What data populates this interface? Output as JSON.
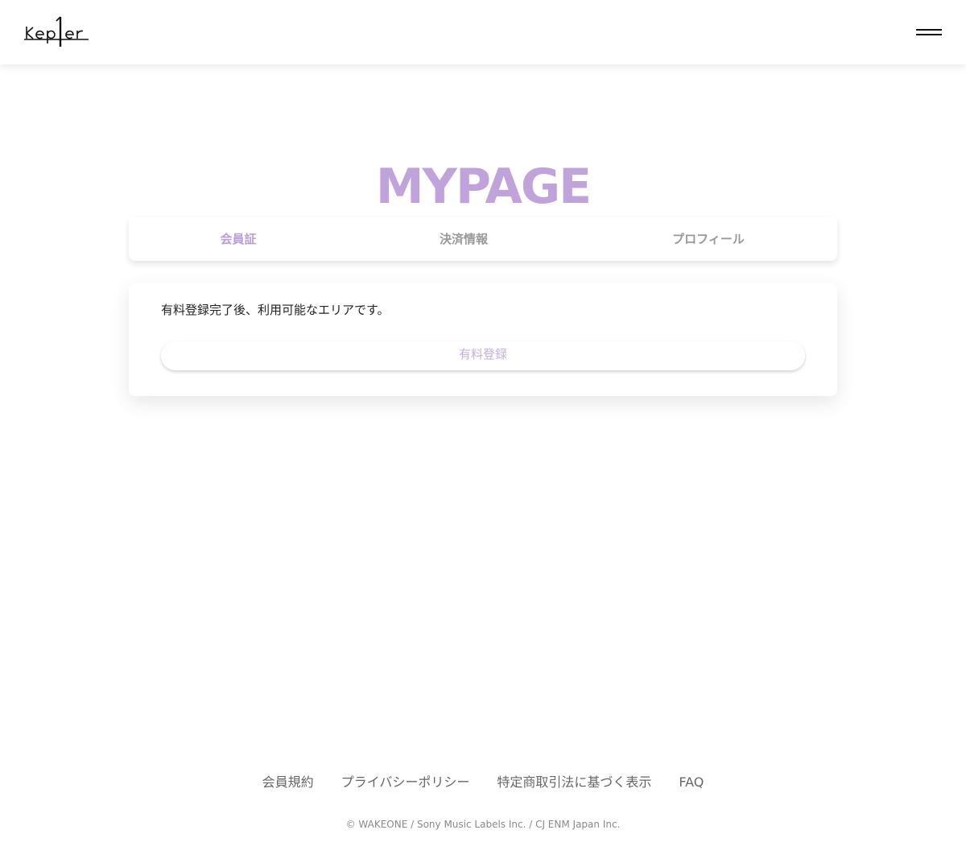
{
  "header": {
    "logo_text": "Kep1er",
    "menu_icon": "hamburger-menu-icon"
  },
  "main": {
    "title": "MYPAGE",
    "tabs": [
      {
        "label": "会員証",
        "active": true
      },
      {
        "label": "決済情報",
        "active": false
      },
      {
        "label": "プロフィール",
        "active": false
      }
    ],
    "card": {
      "message": "有料登録完了後、利用可能なエリアです。",
      "button_label": "有料登録"
    }
  },
  "footer": {
    "links": [
      {
        "label": "会員規約"
      },
      {
        "label": "プライバシーポリシー"
      },
      {
        "label": "特定商取引法に基づく表示"
      },
      {
        "label": "FAQ"
      }
    ],
    "copyright": "© WAKEONE / Sony Music Labels Inc. / CJ ENM Japan Inc."
  },
  "colors": {
    "accent": "#c1a3dc",
    "tab_active": "#b8a0d6",
    "tab_inactive": "#999999",
    "button_text": "#c4b0dc",
    "footer_text": "#666666"
  }
}
